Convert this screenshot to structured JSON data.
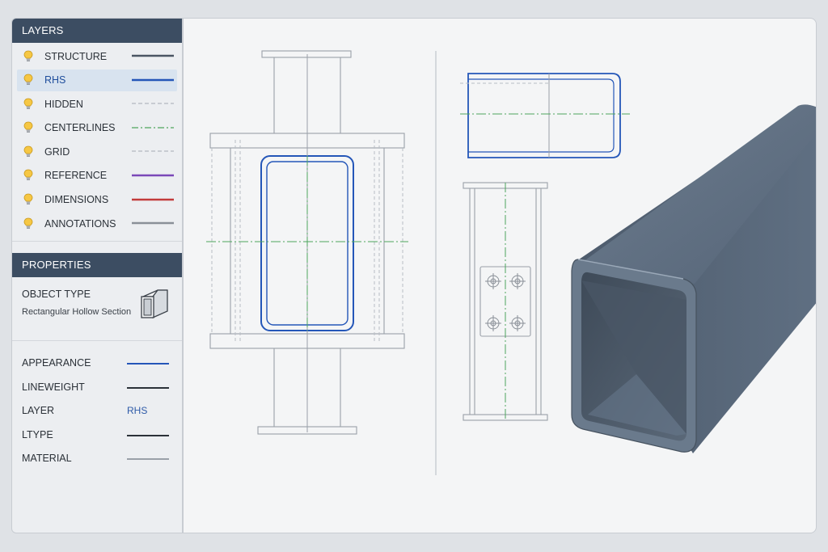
{
  "layers": {
    "title": "LAYERS",
    "items": [
      {
        "label": "STRUCTURE",
        "line_color": "#4a5563",
        "line_style": "solid",
        "selected": false
      },
      {
        "label": "RHS",
        "line_color": "#2456b8",
        "line_style": "solid",
        "selected": true
      },
      {
        "label": "HIDDEN",
        "line_color": "#b3b8bf",
        "line_style": "dashed",
        "selected": false
      },
      {
        "label": "CENTERLINES",
        "line_color": "#4ea55e",
        "line_style": "dashdot",
        "selected": false
      },
      {
        "label": "GRID",
        "line_color": "#b3b8bf",
        "line_style": "dashed",
        "selected": false
      },
      {
        "label": "REFERENCE",
        "line_color": "#7a48b8",
        "line_style": "solid",
        "selected": false
      },
      {
        "label": "DIMENSIONS",
        "line_color": "#c23b3b",
        "line_style": "solid",
        "selected": false
      },
      {
        "label": "ANNOTATIONS",
        "line_color": "#8a9098",
        "line_style": "solid",
        "selected": false
      }
    ]
  },
  "properties": {
    "title": "PROPERTIES",
    "object_type_label": "OBJECT TYPE",
    "object_type_value": "Rectangular Hollow Section",
    "rows": [
      {
        "label": "APPEARANCE",
        "kind": "line",
        "line_color": "#2456b8"
      },
      {
        "label": "LINEWEIGHT",
        "kind": "line",
        "line_color": "#2b3138"
      },
      {
        "label": "LAYER",
        "kind": "text",
        "value": "RHS"
      },
      {
        "label": "LTYPE",
        "kind": "line",
        "line_color": "#2b3138"
      },
      {
        "label": "MATERIAL",
        "kind": "line",
        "line_color": "#9aa0a8"
      }
    ]
  },
  "colors": {
    "rhs_blue": "#2456b8",
    "centerline_green": "#4ea55e",
    "structure_gray": "#9aa0a8",
    "panel_header": "#3c4d62",
    "tube_steel": "#5a6a7c"
  }
}
